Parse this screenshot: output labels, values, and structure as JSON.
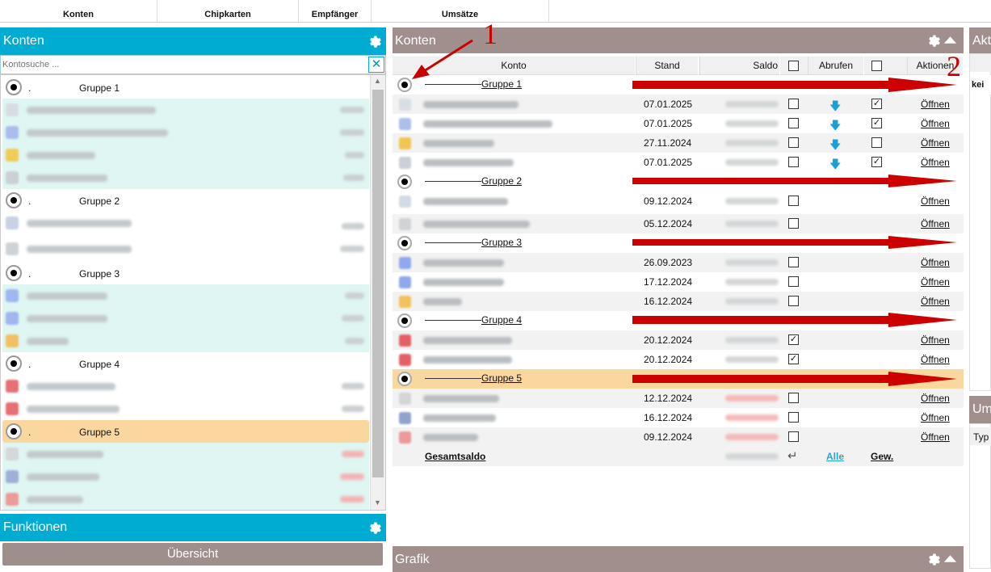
{
  "topbar": {
    "tabs": [
      "Konten",
      "Chipkarten",
      "Empfänger",
      "Umsätze"
    ]
  },
  "left": {
    "title": "Konten",
    "search": {
      "placeholder": "Kontosuche ...",
      "clear": "✕"
    },
    "groups": [
      {
        "label": "Gruppe 1",
        "dot": "."
      },
      {
        "label": "Gruppe 2",
        "dot": "."
      },
      {
        "label": "Gruppe 3",
        "dot": "."
      },
      {
        "label": "Gruppe 4",
        "dot": "."
      },
      {
        "label": "Gruppe 5",
        "dot": "."
      }
    ],
    "functions_title": "Funktionen",
    "overview_button": "Übersicht"
  },
  "main": {
    "title": "Konten",
    "columns": {
      "konto": "Konto",
      "stand": "Stand",
      "saldo": "Saldo",
      "abrufen": "Abrufen",
      "aktionen": "Aktionen"
    },
    "groups": [
      "Gruppe 1",
      "Gruppe 2",
      "Gruppe 3",
      "Gruppe 4",
      "Gruppe 5"
    ],
    "rows": [
      {
        "stand": "07.01.2025",
        "checked": true,
        "open": "Öffnen"
      },
      {
        "stand": "07.01.2025",
        "checked": true,
        "open": "Öffnen"
      },
      {
        "stand": "27.11.2024",
        "checked": false,
        "open": "Öffnen"
      },
      {
        "stand": "07.01.2025",
        "checked": true,
        "open": "Öffnen"
      },
      {
        "stand": "09.12.2024",
        "open": "Öffnen"
      },
      {
        "stand": "05.12.2024",
        "open": "Öffnen"
      },
      {
        "stand": "26.09.2023",
        "open": "Öffnen"
      },
      {
        "stand": "17.12.2024",
        "open": "Öffnen"
      },
      {
        "stand": "16.12.2024",
        "open": "Öffnen"
      },
      {
        "stand": "20.12.2024",
        "saldo_checked": true,
        "open": "Öffnen"
      },
      {
        "stand": "20.12.2024",
        "saldo_checked": true,
        "open": "Öffnen"
      },
      {
        "stand": "12.12.2024",
        "open": "Öffnen"
      },
      {
        "stand": "16.12.2024",
        "open": "Öffnen"
      },
      {
        "stand": "09.12.2024",
        "open": "Öffnen"
      }
    ],
    "footer": {
      "gesamtsaldo": "Gesamtsaldo",
      "alle": "Alle",
      "gew": "Gew."
    },
    "grafik_title": "Grafik"
  },
  "right": {
    "aktu_title": "Akt",
    "kei_text": "kei",
    "ums_title": "Um",
    "typ_label": "Typ"
  },
  "annotations": {
    "label1": "1",
    "label2": "2"
  },
  "colors": {
    "accent": "#00acd1",
    "panel_header": "#a08f8d",
    "selected_row": "#fbd7a0",
    "arrow": "#cc0000"
  }
}
